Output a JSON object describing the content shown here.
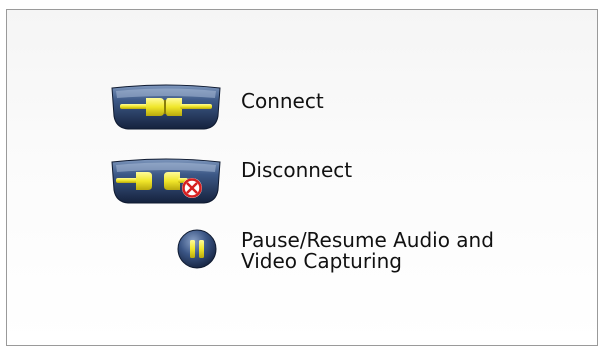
{
  "legend": {
    "items": [
      {
        "id": "connect",
        "icon": "connect-plug-icon",
        "label": "Connect"
      },
      {
        "id": "disconnect",
        "icon": "disconnect-plug-icon",
        "label": "Disconnect"
      },
      {
        "id": "pause",
        "icon": "pause-icon",
        "label_line1": "Pause/Resume Audio and",
        "label_line2": "Video Capturing"
      }
    ]
  },
  "colors": {
    "button_dark": "#1e2f4d",
    "button_mid": "#3f5b87",
    "plug_yellow": "#f0e62a",
    "stop_red": "#d62020"
  }
}
